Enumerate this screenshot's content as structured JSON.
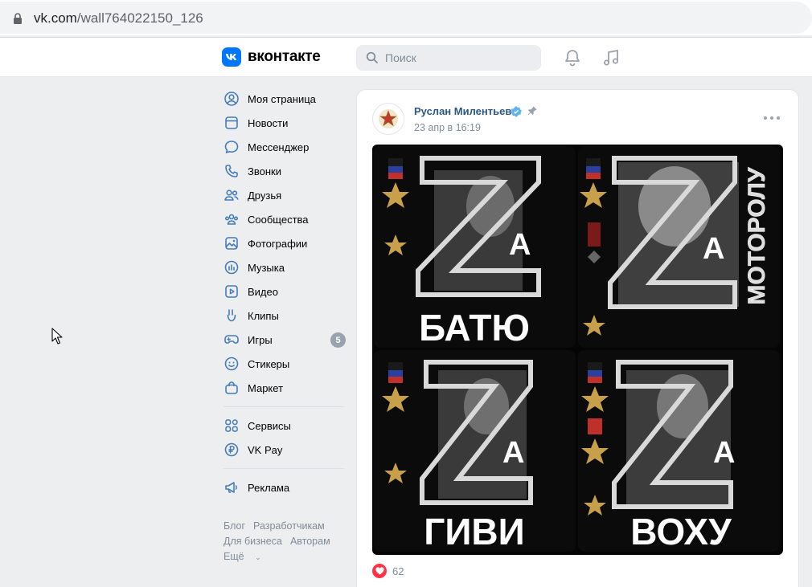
{
  "browser": {
    "url_domain": "vk.com",
    "url_path": "/wall764022150_126"
  },
  "header": {
    "logo_text": "вконтакте",
    "search_placeholder": "Поиск",
    "brand_color": "#0077ff"
  },
  "sidebar": {
    "items": [
      {
        "label": "Моя страница",
        "icon": "user-circle-icon"
      },
      {
        "label": "Новости",
        "icon": "news-icon"
      },
      {
        "label": "Мессенджер",
        "icon": "message-icon"
      },
      {
        "label": "Звонки",
        "icon": "phone-icon"
      },
      {
        "label": "Друзья",
        "icon": "friends-icon"
      },
      {
        "label": "Сообщества",
        "icon": "communities-icon"
      },
      {
        "label": "Фотографии",
        "icon": "photo-icon"
      },
      {
        "label": "Музыка",
        "icon": "music-icon"
      },
      {
        "label": "Видео",
        "icon": "video-icon"
      },
      {
        "label": "Клипы",
        "icon": "clips-icon"
      },
      {
        "label": "Игры",
        "icon": "games-icon",
        "badge": "5"
      },
      {
        "label": "Стикеры",
        "icon": "sticker-icon"
      },
      {
        "label": "Маркет",
        "icon": "market-icon"
      }
    ],
    "services": [
      {
        "label": "Сервисы",
        "icon": "services-icon"
      },
      {
        "label": "VK Pay",
        "icon": "vkpay-icon"
      }
    ],
    "ads": [
      {
        "label": "Реклама",
        "icon": "megaphone-icon"
      }
    ],
    "footer": {
      "blog": "Блог",
      "developers": "Разработчикам",
      "business": "Для бизнеса",
      "authors": "Авторам",
      "more": "Ещё"
    }
  },
  "post": {
    "author": "Руслан Милентьев",
    "date": "23 апр в 16:19",
    "likes": "62",
    "tiles": [
      {
        "letter": "Z",
        "za": "А",
        "caption": "БАТЮ"
      },
      {
        "letter": "Z",
        "za": "А",
        "caption": "МОТОРОЛУ"
      },
      {
        "letter": "Z",
        "za": "А",
        "caption": "ГИВИ"
      },
      {
        "letter": "Z",
        "za": "А",
        "caption": "ВОХУ"
      }
    ]
  }
}
